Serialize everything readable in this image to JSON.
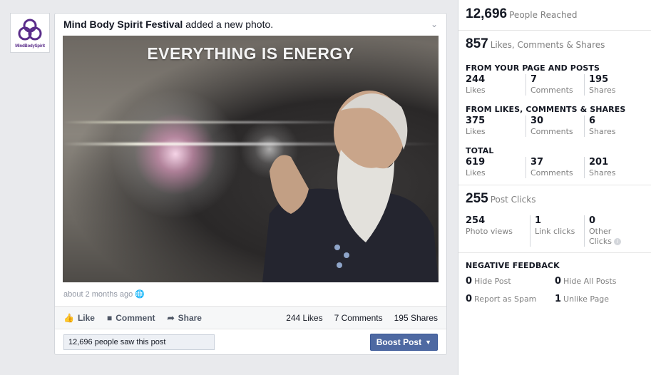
{
  "page": {
    "logo_text": "MindBodySpirit"
  },
  "post": {
    "author": "Mind Body Spirit Festival",
    "action_text": " added a new photo.",
    "photo_caption": "EVERYTHING IS ENERGY",
    "timestamp": "about 2 months ago",
    "actions": {
      "like": "Like",
      "comment": "Comment",
      "share": "Share"
    },
    "counts": {
      "likes": "244 Likes",
      "comments": "7 Comments",
      "shares": "195 Shares"
    },
    "saw_text": "12,696 people saw this post",
    "boost_label": "Boost Post"
  },
  "insights": {
    "reached": {
      "value": "12,696",
      "label": "People Reached"
    },
    "engagement": {
      "value": "857",
      "label": "Likes, Comments & Shares"
    },
    "from_page": {
      "title": "FROM YOUR PAGE AND POSTS",
      "likes": "244",
      "likes_label": "Likes",
      "comments": "7",
      "comments_label": "Comments",
      "shares": "195",
      "shares_label": "Shares"
    },
    "from_lcs": {
      "title": "FROM LIKES, COMMENTS & SHARES",
      "likes": "375",
      "likes_label": "Likes",
      "comments": "30",
      "comments_label": "Comments",
      "shares": "6",
      "shares_label": "Shares"
    },
    "total": {
      "title": "TOTAL",
      "likes": "619",
      "likes_label": "Likes",
      "comments": "37",
      "comments_label": "Comments",
      "shares": "201",
      "shares_label": "Shares"
    },
    "clicks": {
      "value": "255",
      "label": "Post Clicks"
    },
    "click_breakdown": {
      "photo_views": "254",
      "photo_views_label": "Photo views",
      "link_clicks": "1",
      "link_clicks_label": "Link clicks",
      "other_clicks": "0",
      "other_clicks_label_1": "Other",
      "other_clicks_label_2": "Clicks"
    },
    "negative": {
      "title": "NEGATIVE FEEDBACK",
      "hide_post": "0",
      "hide_post_label": "Hide Post",
      "hide_all": "0",
      "hide_all_label": "Hide All Posts",
      "spam": "0",
      "spam_label": "Report as Spam",
      "unlike": "1",
      "unlike_label": "Unlike Page"
    }
  },
  "colors": {
    "brand": "#4e69a2",
    "logo_purple": "#5a2d8a",
    "page_bg": "#e9eaed"
  }
}
